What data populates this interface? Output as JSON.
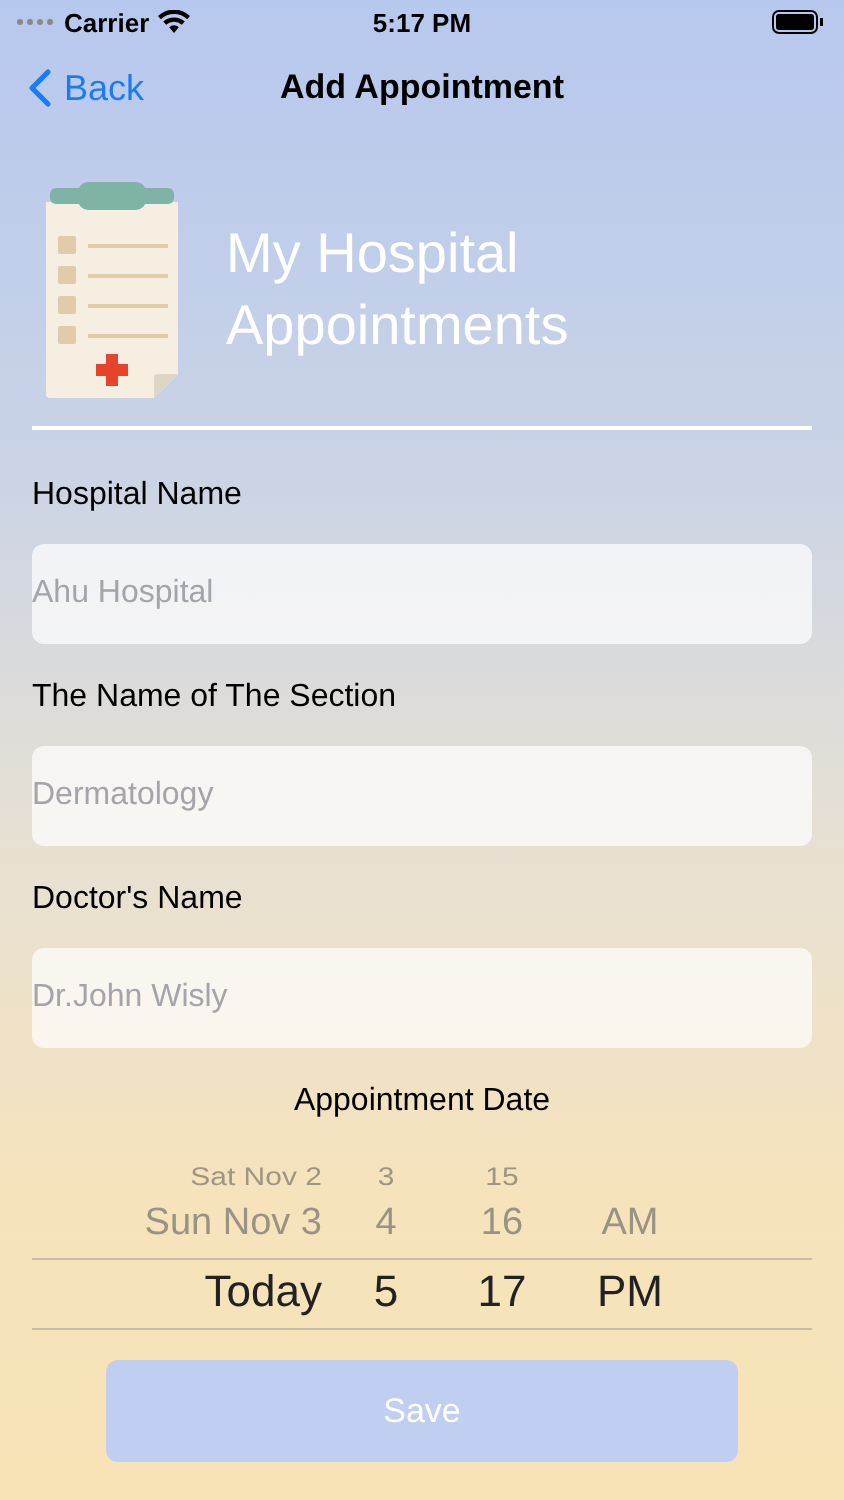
{
  "status_bar": {
    "carrier": "Carrier",
    "time": "5:17 PM"
  },
  "nav": {
    "back": "Back",
    "title": "Add Appointment"
  },
  "header": {
    "title": "My Hospital Appointments"
  },
  "fields": [
    {
      "label": "Hospital Name",
      "placeholder": "Ahu Hospital"
    },
    {
      "label": "The Name of The Section",
      "placeholder": "Dermatology"
    },
    {
      "label": "Doctor's Name",
      "placeholder": "Dr.John Wisly"
    }
  ],
  "date_label": "Appointment Date",
  "picker_rows": [
    {
      "date": "Sat Nov 2",
      "hour": "3",
      "minute": "15",
      "selected": false
    },
    {
      "date": "Sun Nov 3",
      "hour": "4",
      "minute": "16",
      "period": "AM",
      "selected": false
    },
    {
      "date": "Today",
      "hour": "5",
      "minute": "17",
      "period": "PM",
      "selected": true
    }
  ],
  "save_button": {
    "label": "Save",
    "disabled": true
  }
}
